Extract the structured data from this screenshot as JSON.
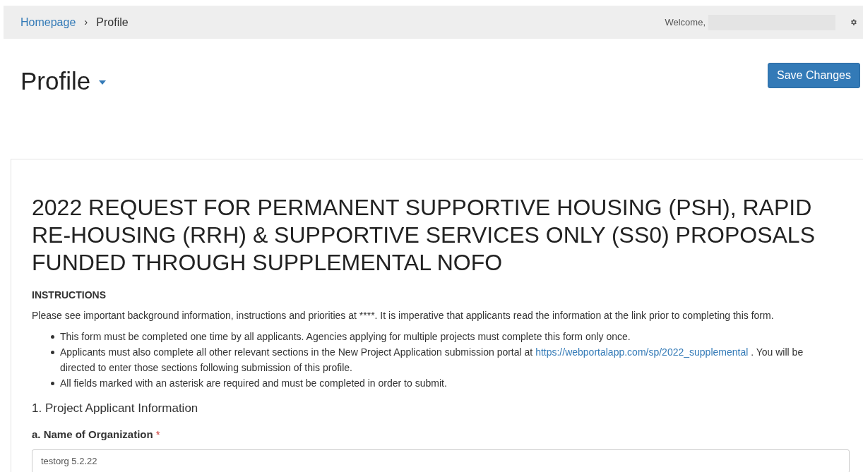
{
  "breadcrumb": [
    {
      "label": "Homepage",
      "link": true
    },
    {
      "separator": "›",
      "label": "Profile",
      "link": false
    }
  ],
  "header": {
    "welcome": "Welcome,"
  },
  "page_title": "Profile",
  "save_button": "Save Changes",
  "form": {
    "title": "2022 REQUEST FOR PERMANENT SUPPORTIVE HOUSING (PSH), RAPID RE-HOUSING (RRH) & SUPPORTIVE SERVICES ONLY (SS0) PROPOSALS FUNDED THROUGH SUPPLEMENTAL NOFO",
    "instructions_heading": "INSTRUCTIONS",
    "instructions_text": "Please see important background information, instructions and priorities at ****. It is imperative that applicants read the information at the link prior to completing this form.",
    "bullets": [
      {
        "text": "This form must be completed one time by all applicants. Agencies applying for multiple projects must complete this form only once."
      },
      {
        "text": "Applicants must also complete all other relevant sections in the New Project Application submission portal at",
        "link": "https://webportalapp.com/sp/2022_supplemental",
        "after": ". You will be directed to enter those sections following submission of this profile."
      },
      {
        "text": "All fields marked with an asterisk are required and must be completed in order to submit."
      }
    ],
    "section": "1. Project Applicant Information",
    "fields": [
      {
        "label": "a. Name of Organization",
        "required_mark": "*",
        "value": "testorg 5.2.22"
      }
    ]
  }
}
